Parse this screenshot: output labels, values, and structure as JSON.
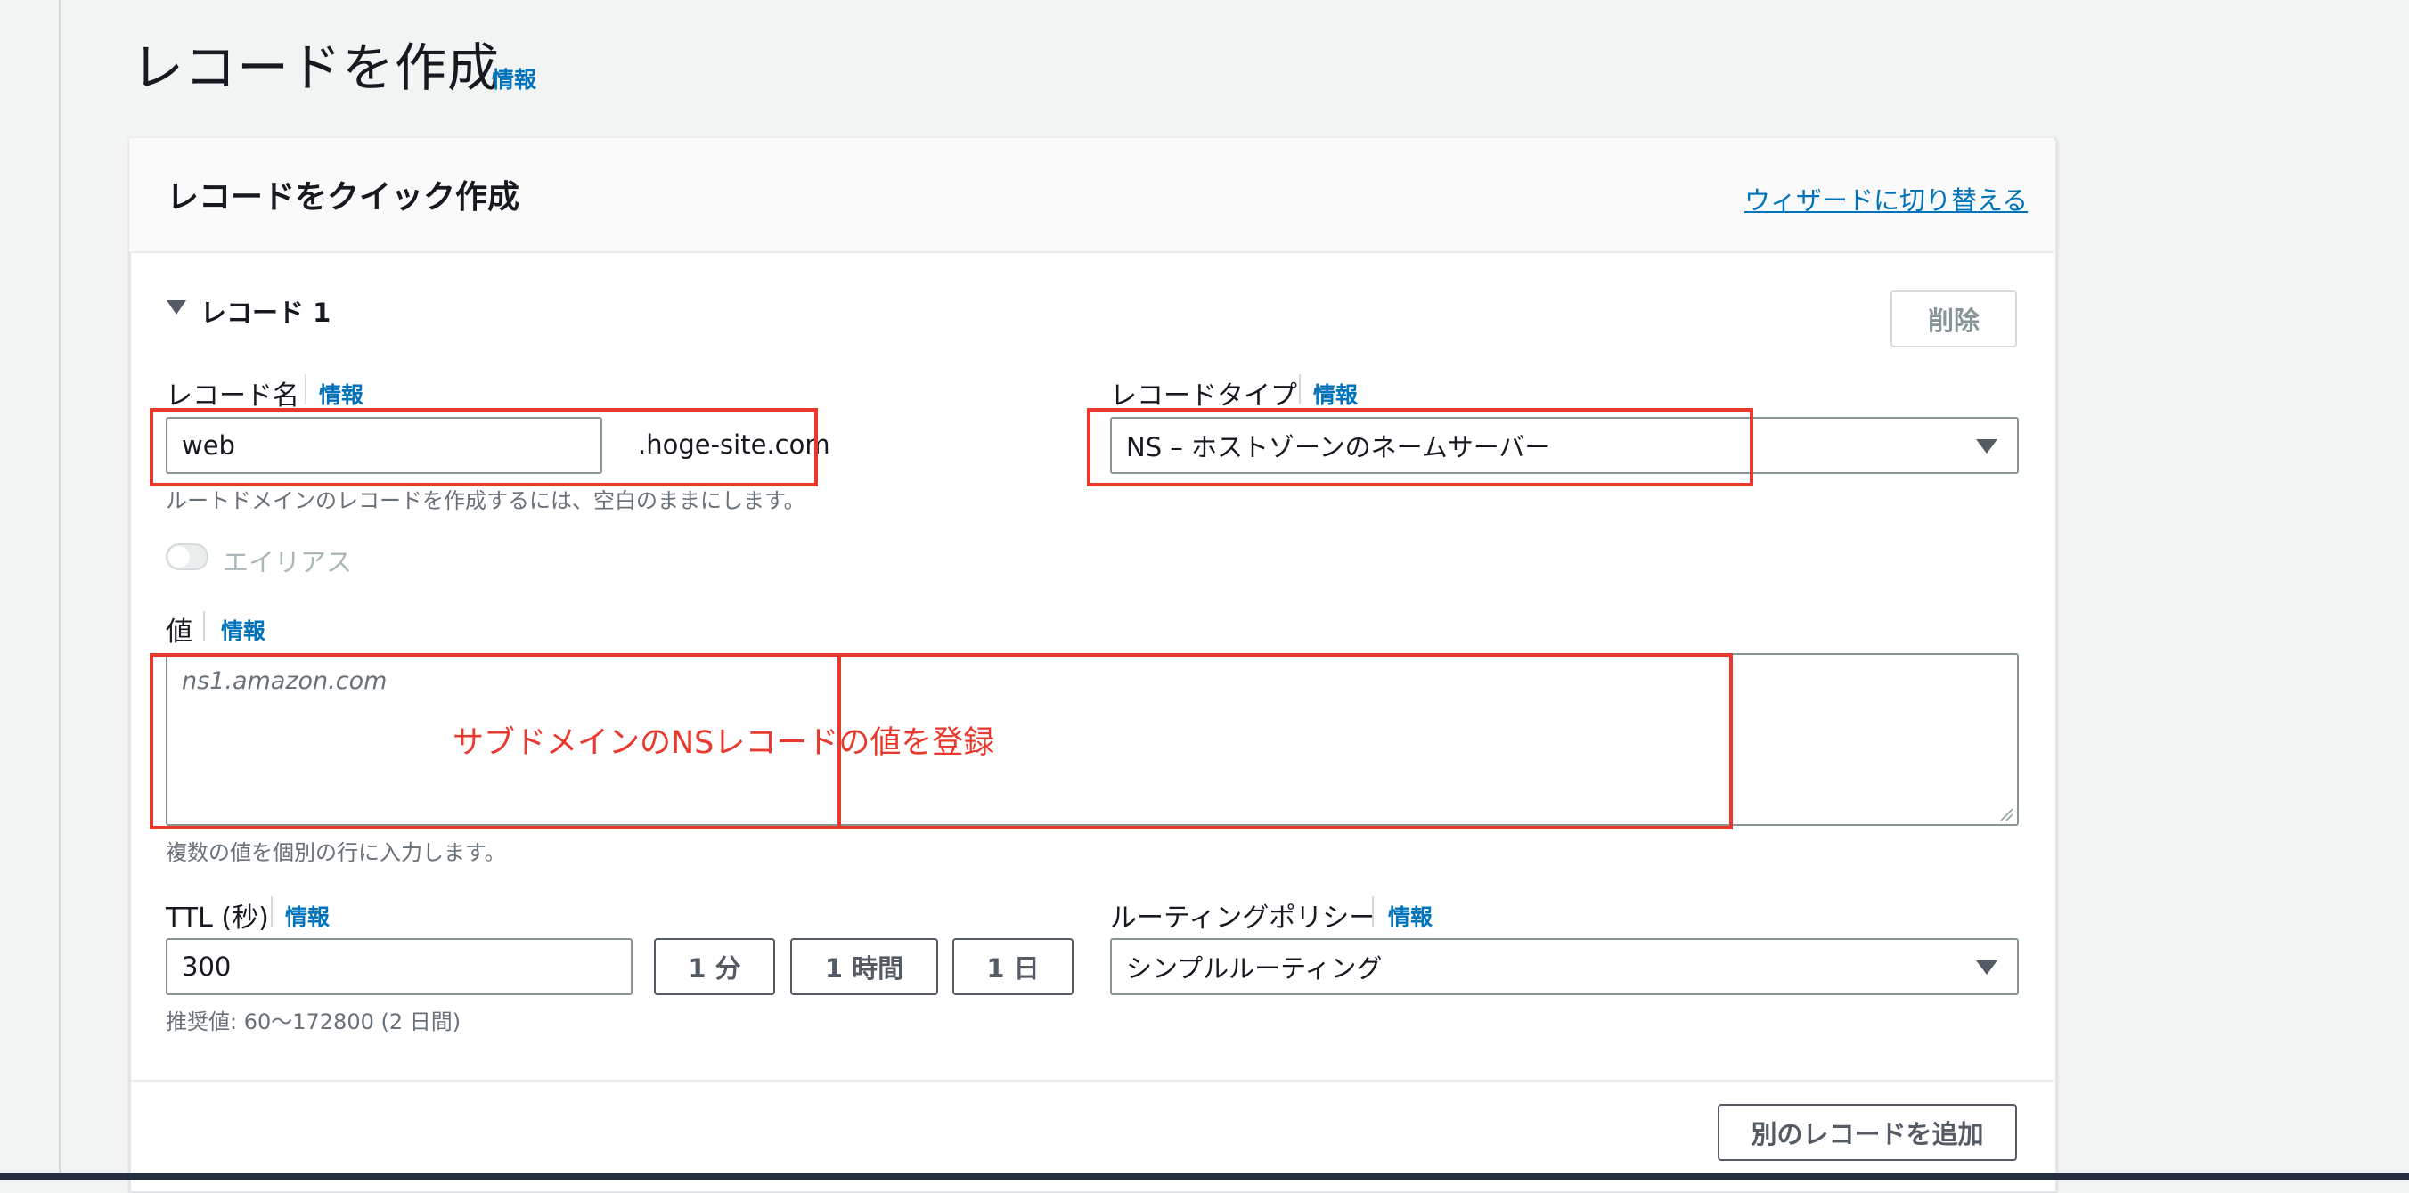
{
  "page": {
    "title": "レコードを作成",
    "title_info": "情報"
  },
  "panel": {
    "title": "レコードをクイック作成",
    "wizard_link": "ウィザードに切り替える"
  },
  "record": {
    "section_title": "レコード 1",
    "delete_label": "削除",
    "name": {
      "label": "レコード名",
      "info": "情報",
      "value": "web",
      "suffix": ".hoge-site.com",
      "hint": "ルートドメインのレコードを作成するには、空白のままにします。"
    },
    "type": {
      "label": "レコードタイプ",
      "info": "情報",
      "value": "NS – ホストゾーンのネームサーバー"
    },
    "alias": {
      "label": "エイリアス",
      "enabled": false
    },
    "value": {
      "label": "値",
      "info": "情報",
      "placeholder": "ns1.amazon.com",
      "hint": "複数の値を個別の行に入力します。"
    },
    "ttl": {
      "label": "TTL (秒)",
      "info": "情報",
      "value": "300",
      "presets": [
        "1 分",
        "1 時間",
        "1 日"
      ],
      "hint": "推奨値: 60〜172800 (2 日間)"
    },
    "routing": {
      "label": "ルーティングポリシー",
      "info": "情報",
      "value": "シンプルルーティング"
    }
  },
  "add_record_label": "別のレコードを追加",
  "annotation": {
    "text": "サブドメインのNSレコードの値を登録",
    "color": "#e8392e"
  },
  "colors": {
    "link": "#0073bb",
    "annotation_box": "#e8392e"
  }
}
